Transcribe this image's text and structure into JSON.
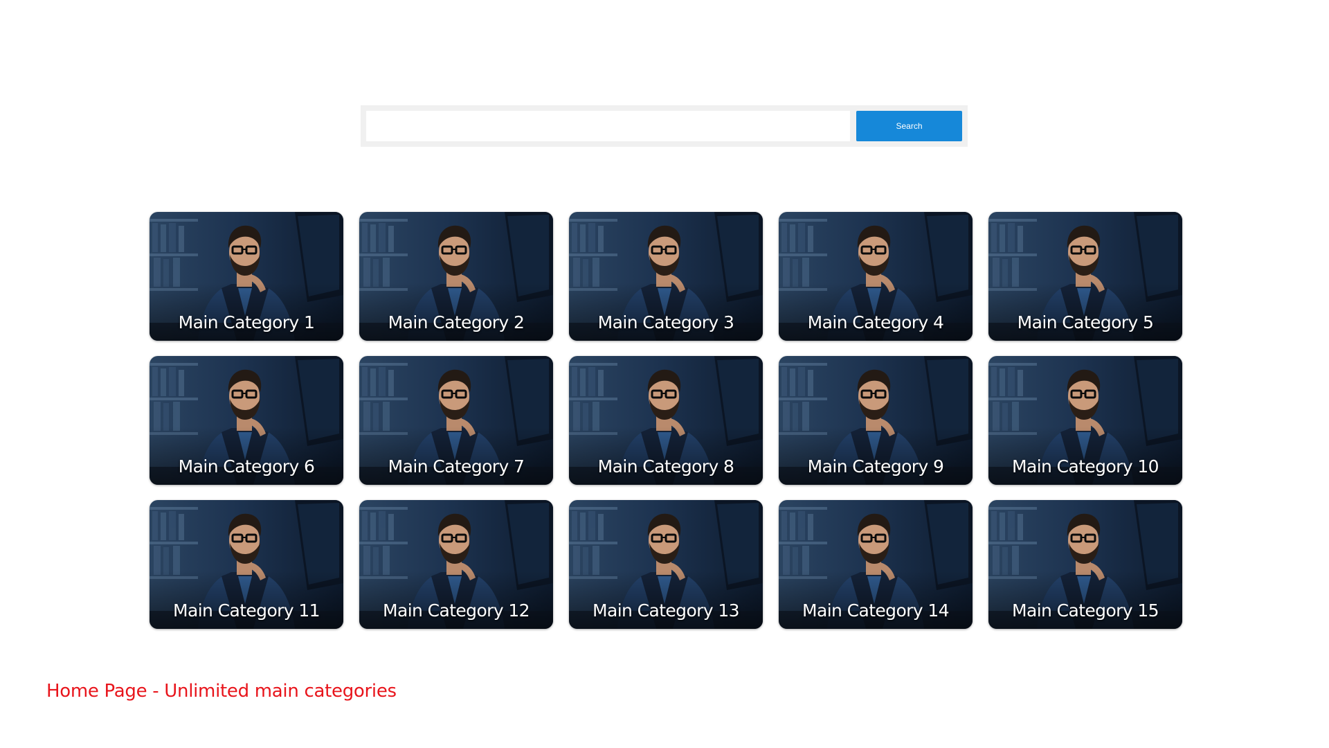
{
  "search": {
    "value": "",
    "button_label": "Search"
  },
  "categories": [
    {
      "label": "Main Category 1"
    },
    {
      "label": "Main Category 2"
    },
    {
      "label": "Main Category 3"
    },
    {
      "label": "Main Category 4"
    },
    {
      "label": "Main Category 5"
    },
    {
      "label": "Main Category 6"
    },
    {
      "label": "Main Category 7"
    },
    {
      "label": "Main Category 8"
    },
    {
      "label": "Main Category 9"
    },
    {
      "label": "Main Category 10"
    },
    {
      "label": "Main Category 11"
    },
    {
      "label": "Main Category 12"
    },
    {
      "label": "Main Category 13"
    },
    {
      "label": "Main Category 14"
    },
    {
      "label": "Main Category 15"
    }
  ],
  "caption": "Home Page - Unlimited main categories",
  "colors": {
    "search_button": "#1688d9",
    "caption": "#e8141b",
    "card_overlay": "#1b2f4a"
  }
}
